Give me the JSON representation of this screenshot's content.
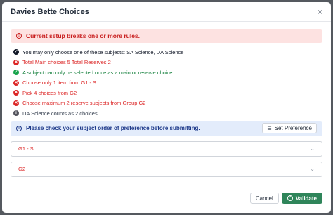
{
  "dialog": {
    "title": "Davies Bette Choices",
    "close_glyph": "×"
  },
  "error_banner": {
    "text": "Current setup breaks one or more rules.",
    "icon": "exclamation-circle-icon"
  },
  "rules": [
    {
      "status": "check",
      "glyph": "✓",
      "text": "You may only choose one of these subjects: SA Science, DA Science"
    },
    {
      "status": "error",
      "glyph": "✕",
      "text": "Total Main choices 5 Total Reserves 2"
    },
    {
      "status": "ok",
      "glyph": "✓",
      "text": "A subject can only be selected once as a main or reserve choice"
    },
    {
      "status": "error",
      "glyph": "✕",
      "text": "Choose only 1 item from G1 - S"
    },
    {
      "status": "error",
      "glyph": "✕",
      "text": "Pick 4 choices from G2"
    },
    {
      "status": "error",
      "glyph": "✕",
      "text": "Choose maximum 2 reserve subjects from Group G2"
    },
    {
      "status": "info",
      "glyph": "i",
      "text": "DA Science counts as 2 choices"
    }
  ],
  "info_banner": {
    "text": "Please check your subject order of preference before submitting.",
    "button_label": "Set Preference"
  },
  "groups": [
    {
      "label": "G1 - S"
    },
    {
      "label": "G2"
    }
  ],
  "footer": {
    "cancel_label": "Cancel",
    "validate_label": "Validate"
  },
  "colors": {
    "error": "#dc2626",
    "success": "#15803d",
    "info_bg": "#e3ecfb",
    "error_bg": "#fde2e1",
    "validate_bg": "#2f855a"
  }
}
